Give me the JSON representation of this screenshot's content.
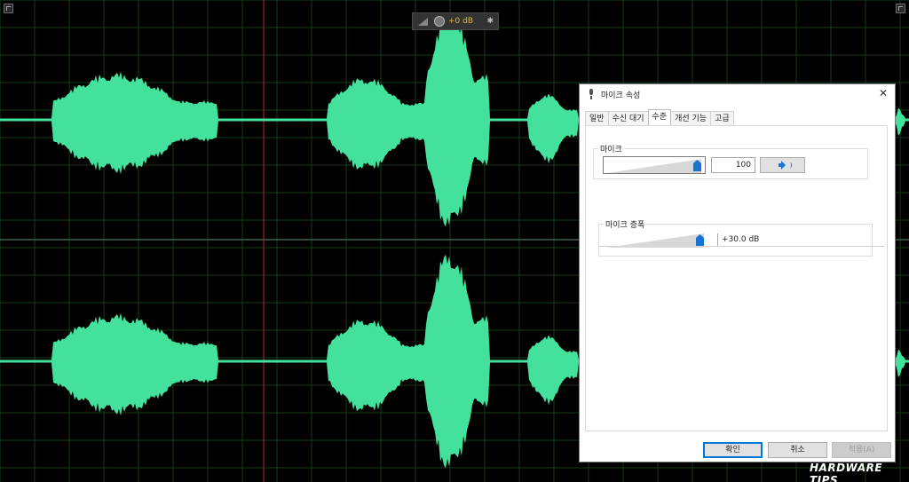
{
  "hud": {
    "gain_text": "+0 dB"
  },
  "watermark": "HARDWARE TIPS",
  "dialog": {
    "title": "마이크 속성",
    "close_glyph": "✕",
    "tabs": [
      {
        "label": "일반"
      },
      {
        "label": "수신 대기"
      },
      {
        "label": "수준",
        "active": true
      },
      {
        "label": "개선 기능"
      },
      {
        "label": "고급"
      }
    ],
    "mic_group": {
      "label": "마이크",
      "value": "100",
      "level_percent": 100
    },
    "boost_group": {
      "label": "마이크 증폭",
      "value": "+30.0 dB",
      "level_percent": 100
    },
    "buttons": {
      "ok": "확인",
      "cancel": "취소",
      "apply": "적용(A)"
    }
  },
  "colors": {
    "waveform": "#43e19b",
    "grid": "#1a3a1a",
    "playhead": "#b02a2a",
    "accent": "#1a73d1"
  }
}
